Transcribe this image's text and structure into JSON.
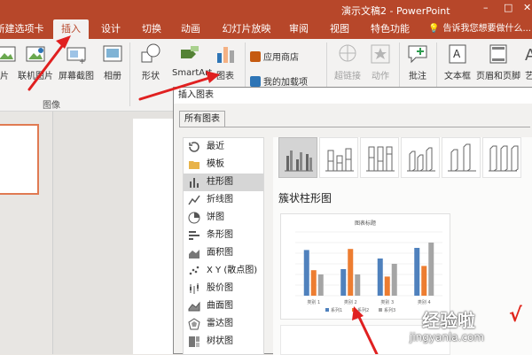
{
  "window": {
    "title": "演示文稿2 - PowerPoint",
    "controls": [
      "–",
      "□",
      "✕"
    ]
  },
  "tabs": [
    {
      "label": "新建选项卡"
    },
    {
      "label": "插入",
      "active": true
    },
    {
      "label": "设计"
    },
    {
      "label": "切换"
    },
    {
      "label": "动画"
    },
    {
      "label": "幻灯片放映"
    },
    {
      "label": "审阅"
    },
    {
      "label": "视图"
    },
    {
      "label": "特色功能"
    }
  ],
  "tell_me": "告诉我您想要做什么...",
  "ribbon": {
    "picture_label": "片",
    "online_pictures": "联机图片",
    "screenshot": "屏幕截图",
    "album": "相册",
    "images_group": "图像",
    "shapes": "形状",
    "smartart": "SmartArt",
    "chart": "图表",
    "store": "应用商店",
    "my_addins": "我的加载项",
    "hyperlink": "超链接",
    "action": "动作",
    "comment": "批注",
    "textbox": "文本框",
    "header_footer": "页眉和页脚",
    "art_text": "艺"
  },
  "dialog": {
    "title": "插入图表",
    "tab": "所有图表",
    "categories": [
      "最近",
      "模板",
      "柱形图",
      "折线图",
      "饼图",
      "条形图",
      "面积图",
      "X Y (散点图)",
      "股价图",
      "曲面图",
      "雷达图",
      "树状图"
    ],
    "selected_category": "柱形图",
    "chart_type_name": "簇状柱形图"
  },
  "preview_chart": {
    "title": "图表标题"
  },
  "chart_data": {
    "type": "bar",
    "title": "图表标题",
    "categories": [
      "类别 1",
      "类别 2",
      "类别 3",
      "类别 4"
    ],
    "series": [
      {
        "name": "系列1",
        "values": [
          4.3,
          2.5,
          3.5,
          4.5
        ]
      },
      {
        "name": "系列2",
        "values": [
          2.4,
          4.4,
          1.8,
          2.8
        ]
      },
      {
        "name": "系列3",
        "values": [
          2,
          2,
          3,
          5
        ]
      }
    ],
    "ylim": [
      0,
      6
    ],
    "legend": "bottom",
    "colors": [
      "#4f81bd",
      "#ed7d31",
      "#a5a5a5"
    ]
  },
  "watermark": {
    "cn": "经验啦",
    "check": "√",
    "url": "jingyanla.com"
  },
  "colors": {
    "accent": "#b7472a",
    "arrow": "#e02020"
  }
}
